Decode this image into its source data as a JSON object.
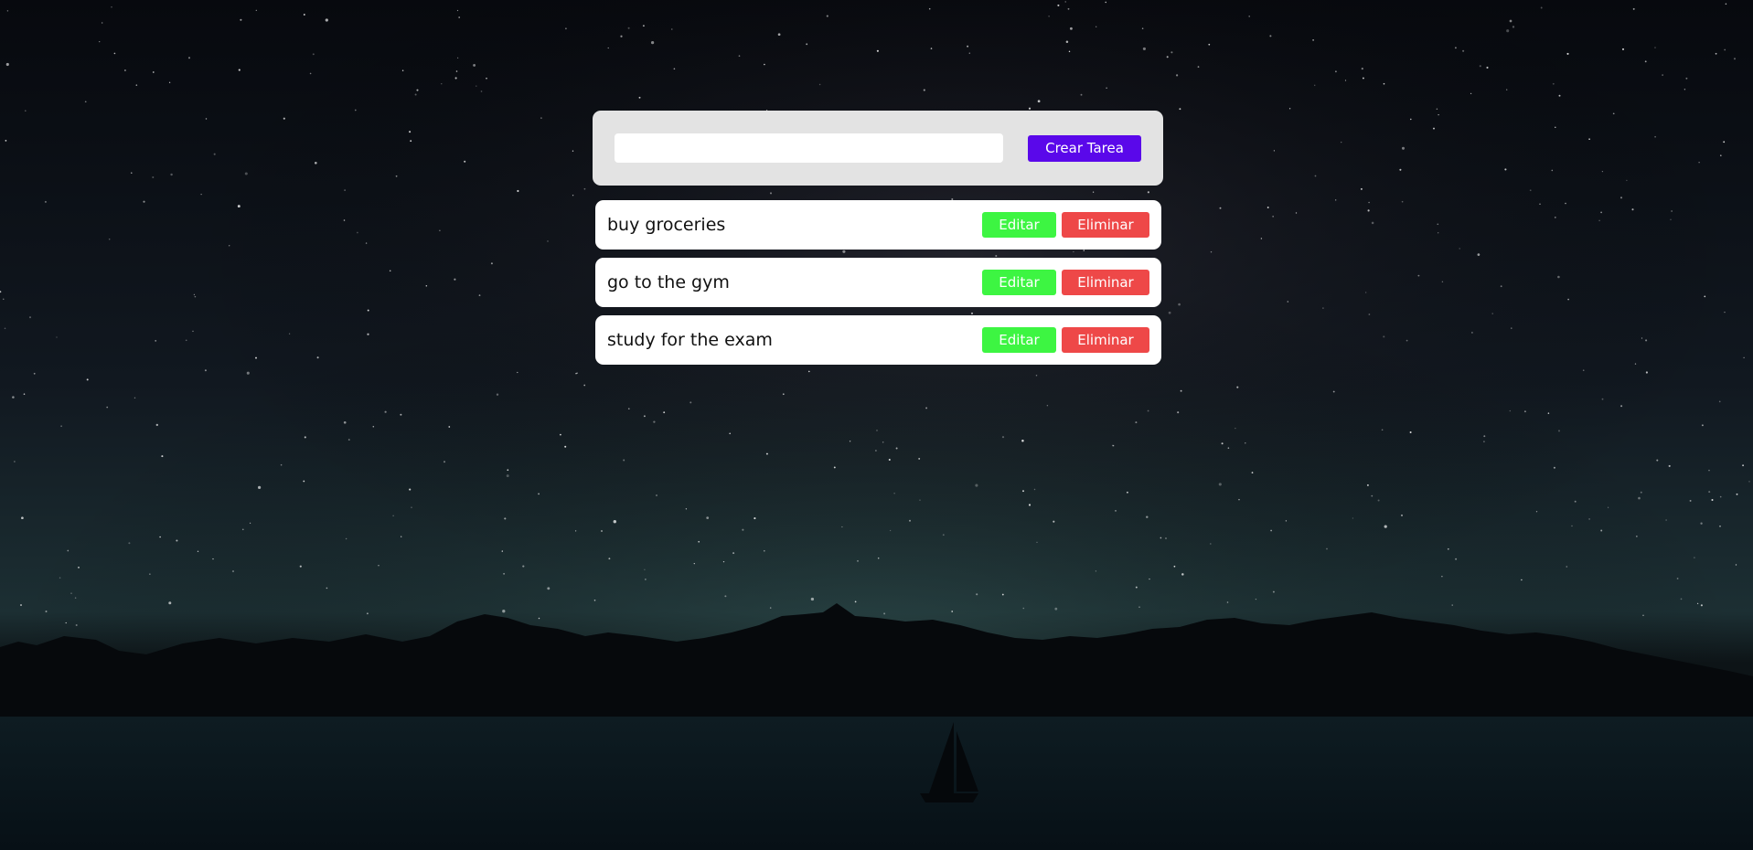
{
  "create_form": {
    "input_value": "",
    "input_placeholder": "",
    "create_label": "Crear Tarea"
  },
  "tasks": [
    {
      "text": "buy groceries",
      "edit_label": "Editar",
      "delete_label": "Eliminar"
    },
    {
      "text": "go to the gym",
      "edit_label": "Editar",
      "delete_label": "Eliminar"
    },
    {
      "text": "study for the exam",
      "edit_label": "Editar",
      "delete_label": "Eliminar"
    }
  ],
  "colors": {
    "create_button": "#5a08ea",
    "edit_button": "#3df542",
    "delete_button": "#ee4848",
    "form_panel": "#e3e3e3",
    "task_card": "#ffffff"
  }
}
